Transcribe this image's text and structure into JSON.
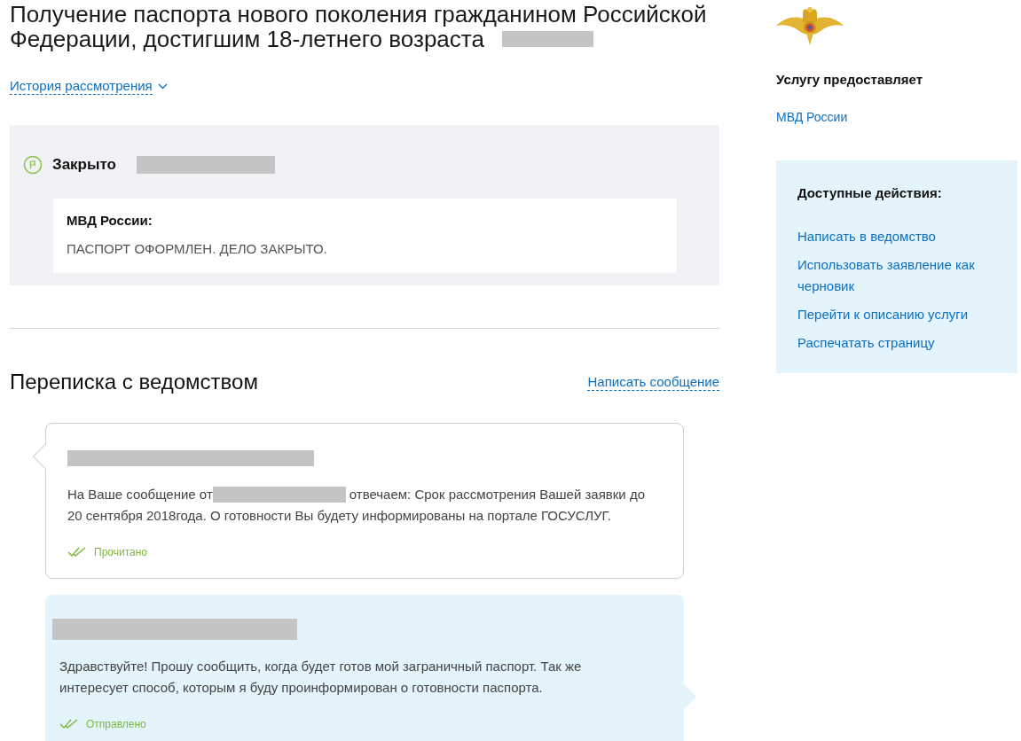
{
  "title": "Получение паспорта нового поколения гражданином Российской Федерации, достигшим 18-летнего возраста",
  "history_link": "История рассмотрения",
  "status": {
    "label": "Закрыто",
    "comment": {
      "author": "МВД России:",
      "text": "ПАСПОРТ ОФОРМЛЕН. ДЕЛО ЗАКРЫТО."
    }
  },
  "correspondence": {
    "heading": "Переписка с ведомством",
    "write_link": "Написать сообщение",
    "messages": [
      {
        "kind": "incoming",
        "text_before": "На Ваше сообщение от",
        "text_after": "отвечаем: Срок рассмотрения Вашей заявки до 20 сентября 2018года. О готовности Вы будету информированы на портале ГОСУСЛУГ.",
        "status": "Прочитано"
      },
      {
        "kind": "outgoing",
        "text_after": "Здравствуйте! Прошу сообщить, когда будет готов мой заграничный паспорт. Так же интересует способ, которым я буду проинформирован о готовности паспорта.",
        "status": "Отправлено"
      }
    ]
  },
  "sidebar": {
    "provider_label": "Услугу предоставляет",
    "provider": "МВД России",
    "actions_title": "Доступные действия:",
    "actions": [
      "Написать в ведомство",
      "Использовать заявление как черновик",
      "Перейти к описанию услуги",
      "Распечатать страницу"
    ]
  }
}
